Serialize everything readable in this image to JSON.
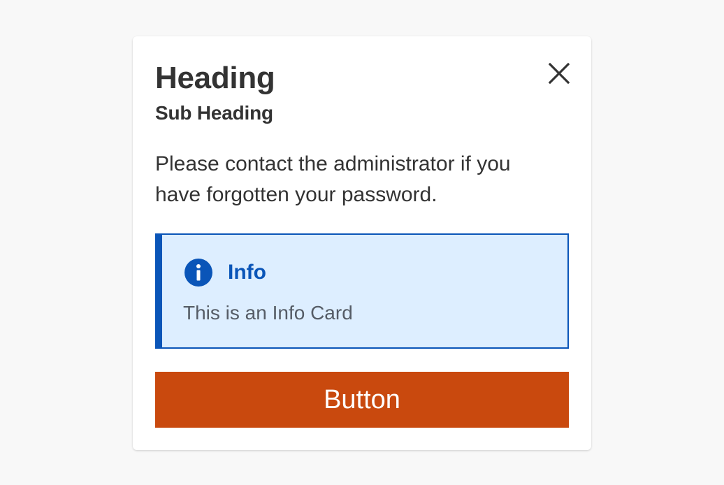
{
  "modal": {
    "heading": "Heading",
    "subheading": "Sub Heading",
    "body_text": "Please contact the administrator if you have forgotten your password.",
    "close_icon": "close-icon"
  },
  "info_card": {
    "title": "Info",
    "text": "This is an Info Card",
    "icon": "info-icon"
  },
  "actions": {
    "primary_label": "Button"
  },
  "colors": {
    "page_background": "#f8f8f8",
    "card_background": "#ffffff",
    "text": "#333333",
    "info_accent": "#0a55b8",
    "info_background": "#ddeeff",
    "info_text": "#555c66",
    "button_background": "#c9490e",
    "button_text": "#ffffff"
  }
}
